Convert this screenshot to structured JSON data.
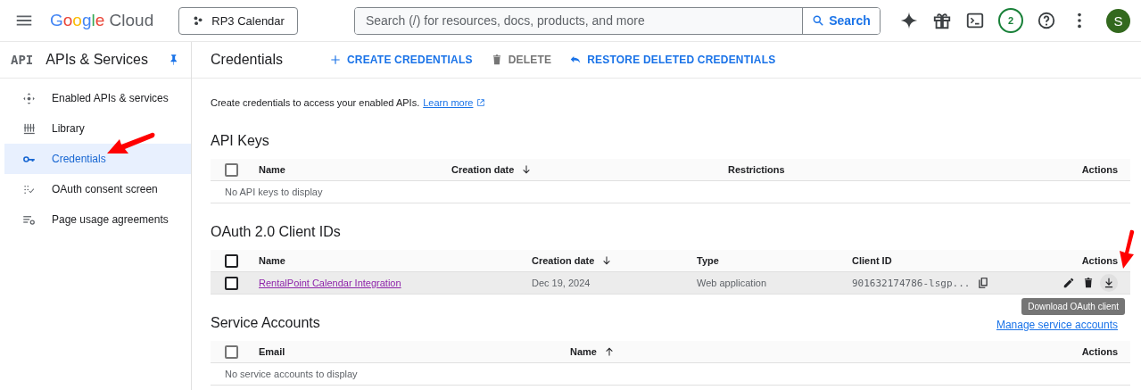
{
  "top_bar": {
    "logo": "Google Cloud",
    "project": "RP3 Calendar",
    "search": {
      "placeholder": "Search (/) for resources, docs, products, and more",
      "button": "Search"
    },
    "notification_count": "2",
    "avatar": "S"
  },
  "sidebar": {
    "badge": "API",
    "title": "APIs & Services",
    "pinned": true,
    "items": [
      {
        "label": "Enabled APIs & services",
        "selected": false
      },
      {
        "label": "Library",
        "selected": false
      },
      {
        "label": "Credentials",
        "selected": true
      },
      {
        "label": "OAuth consent screen",
        "selected": false
      },
      {
        "label": "Page usage agreements",
        "selected": false
      }
    ]
  },
  "header": {
    "title": "Credentials",
    "actions": [
      {
        "label": "CREATE CREDENTIALS",
        "disabled": false
      },
      {
        "label": "DELETE",
        "disabled": true
      },
      {
        "label": "RESTORE DELETED CREDENTIALS",
        "disabled": false
      }
    ]
  },
  "description": {
    "text": "Create credentials to access your enabled APIs.",
    "link": "Learn more"
  },
  "sections": [
    {
      "title": "API Keys",
      "header_checkbox": {
        "checked": false,
        "disabled": true
      },
      "columns": [
        {
          "label": "Name"
        },
        {
          "label": "Creation date",
          "sorted": true,
          "ascending": false
        },
        {
          "label": "Restrictions"
        },
        {
          "label": "Actions"
        }
      ],
      "empty_text": "No API keys to display"
    },
    {
      "title": "OAuth 2.0 Client IDs",
      "header_checkbox": {
        "checked": false,
        "disabled": false
      },
      "columns": [
        {
          "label": "Name"
        },
        {
          "label": "Creation date",
          "sorted": true,
          "ascending": false
        },
        {
          "label": "Type"
        },
        {
          "label": "Client ID"
        },
        {
          "label": "Actions"
        }
      ],
      "rows": [
        {
          "checked": false,
          "highlighted": true,
          "name": "RentalPoint Calendar Integration",
          "creation_date": "Dec 19, 2024",
          "type": "Web application",
          "client_id": "901632174786-lsgp...",
          "tooltip": "Download OAuth client"
        }
      ]
    },
    {
      "title": "Service Accounts",
      "link": "Manage service accounts",
      "header_checkbox": {
        "checked": false,
        "disabled": true
      },
      "columns": [
        {
          "label": "Email"
        },
        {
          "label": "Name",
          "sorted": true,
          "ascending": true
        },
        {
          "label": "Actions"
        }
      ],
      "empty_text": "No service accounts to display"
    }
  ]
}
